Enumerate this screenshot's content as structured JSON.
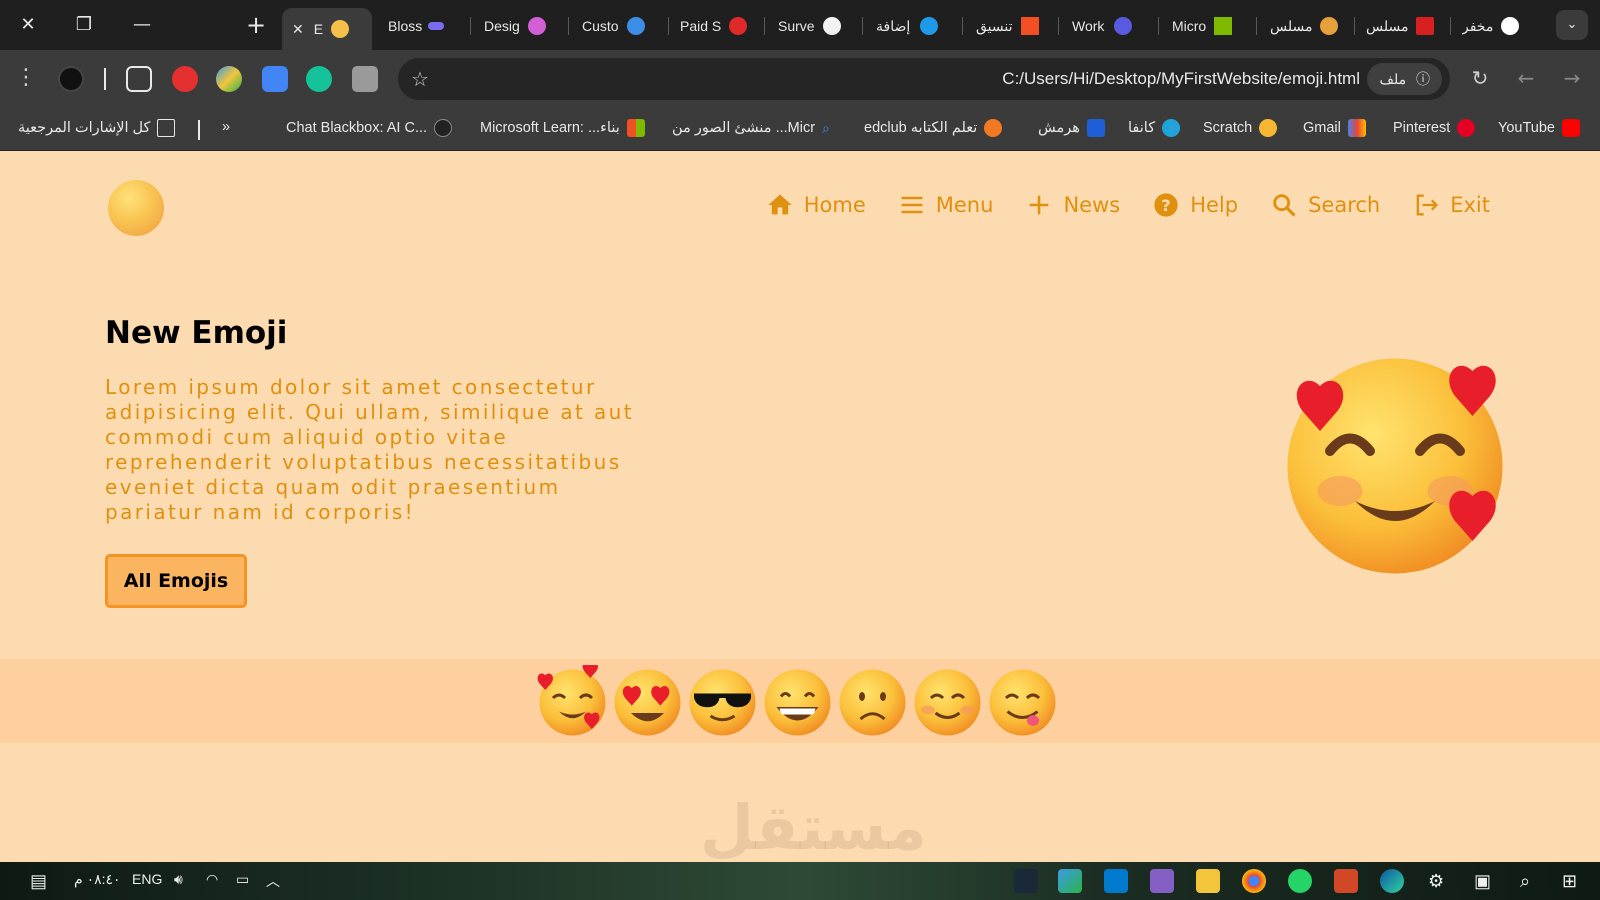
{
  "browser": {
    "tabs": [
      {
        "label": "E",
        "active": true
      },
      {
        "label": "Bloss"
      },
      {
        "label": "Desig"
      },
      {
        "label": "Custo"
      },
      {
        "label": "Paid S"
      },
      {
        "label": "Surve"
      },
      {
        "label": "إضافة"
      },
      {
        "label": "تنسيق"
      },
      {
        "label": "Work"
      },
      {
        "label": "Micro"
      },
      {
        "label": "مسلس"
      },
      {
        "label": "مسلس"
      },
      {
        "label": "مخفر"
      }
    ],
    "url": "C:/Users/Hi/Desktop/MyFirstWebsite/emoji.html",
    "file_chip": "ملف",
    "bookmarks": [
      {
        "label": "YouTube"
      },
      {
        "label": "Pinterest"
      },
      {
        "label": "Gmail"
      },
      {
        "label": "Scratch"
      },
      {
        "label": "كانفا"
      },
      {
        "label": "هرمش"
      },
      {
        "label": "edclub تعلم الكتابه"
      },
      {
        "label": "منشئ الصور من ...Micr"
      },
      {
        "label": "Microsoft Learn: ...بناء"
      },
      {
        "label": "Chat Blackbox: AI C..."
      },
      {
        "label": "كل الإشارات المرجعية"
      }
    ],
    "overflow_chevron": "»"
  },
  "page": {
    "nav": [
      {
        "label": "Home",
        "icon": "home-icon"
      },
      {
        "label": "Menu",
        "icon": "menu-icon"
      },
      {
        "label": "News",
        "icon": "plus-icon"
      },
      {
        "label": "Help",
        "icon": "help-icon"
      },
      {
        "label": "Search",
        "icon": "search-icon"
      },
      {
        "label": "Exit",
        "icon": "exit-icon"
      }
    ],
    "hero": {
      "title": "New Emoji",
      "text": "Lorem ipsum dolor sit amet consectetur adipisicing elit. Qui ullam, similique at aut commodi cum aliquid optio vitae reprehenderit voluptatibus necessitatibus eveniet dicta quam odit praesentium pariatur nam id corporis!",
      "button": "All Emojis"
    },
    "emoji_strip": [
      "smiling-face-with-hearts",
      "heart-eyes",
      "sunglasses",
      "grinning",
      "frowning",
      "blushing",
      "yum"
    ],
    "watermark": "مستقل",
    "colors": {
      "accent": "#e0900f",
      "page_bg": "#fddbb0",
      "strip_bg": "#fed0a0",
      "button_bg": "#fbb561",
      "button_border": "#f59324"
    }
  },
  "taskbar": {
    "time": "٠٨:٤٠ م",
    "lang": "ENG"
  }
}
